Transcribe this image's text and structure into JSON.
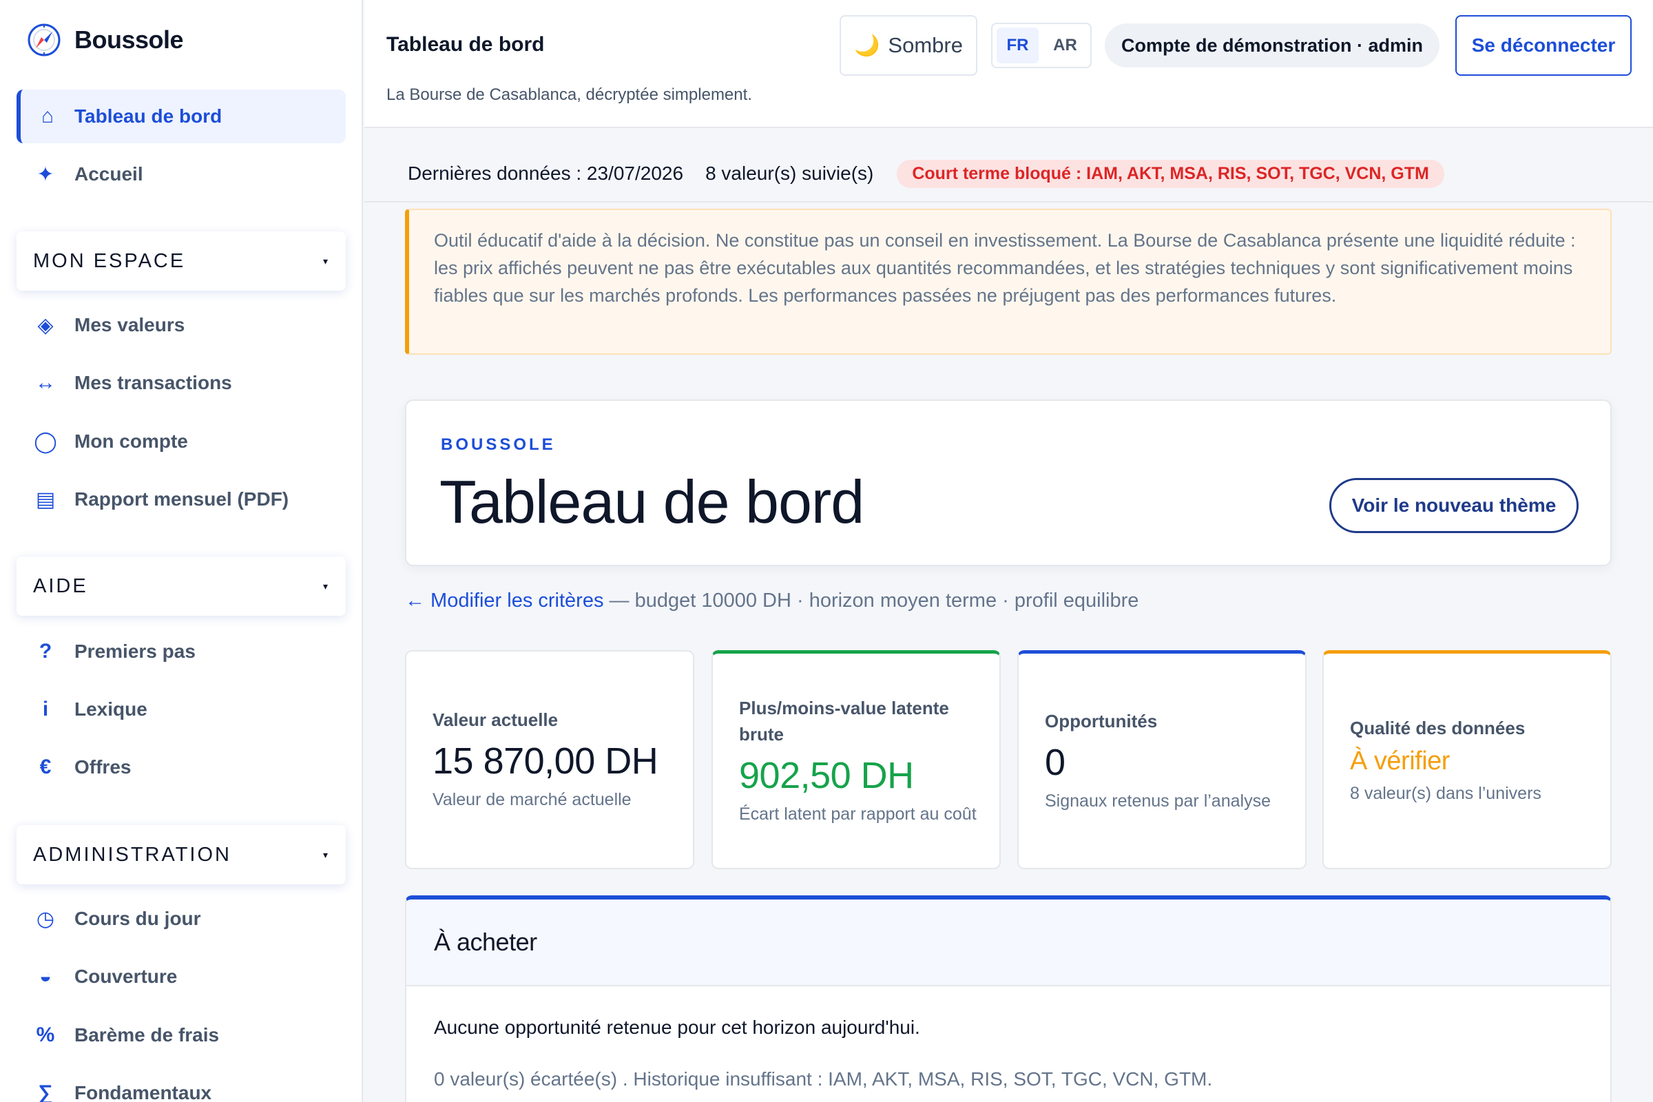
{
  "brand": {
    "name": "Boussole"
  },
  "sidebar": {
    "primary": [
      {
        "label": "Tableau de bord",
        "icon": "home-icon",
        "glyph": "⌂",
        "active": true
      },
      {
        "label": "Accueil",
        "icon": "sparkle-icon",
        "glyph": "✦",
        "active": false
      }
    ],
    "sections": [
      {
        "title": "MON ESPACE",
        "items": [
          {
            "label": "Mes valeurs",
            "icon": "diamond-icon",
            "glyph": "◈"
          },
          {
            "label": "Mes transactions",
            "icon": "arrows-horizontal-icon",
            "glyph": "↔"
          },
          {
            "label": "Mon compte",
            "icon": "circle-icon",
            "glyph": "◯"
          },
          {
            "label": "Rapport mensuel (PDF)",
            "icon": "document-icon",
            "glyph": "▤"
          }
        ]
      },
      {
        "title": "AIDE",
        "items": [
          {
            "label": "Premiers pas",
            "icon": "question-icon",
            "glyph": "?"
          },
          {
            "label": "Lexique",
            "icon": "info-icon",
            "glyph": "i"
          },
          {
            "label": "Offres",
            "icon": "euro-icon",
            "glyph": "€"
          }
        ]
      },
      {
        "title": "ADMINISTRATION",
        "items": [
          {
            "label": "Cours du jour",
            "icon": "clock-icon",
            "glyph": "◷"
          },
          {
            "label": "Couverture",
            "icon": "half-circle-icon",
            "glyph": "◒"
          },
          {
            "label": "Barème de frais",
            "icon": "percent-icon",
            "glyph": "%"
          },
          {
            "label": "Fondamentaux",
            "icon": "sigma-icon",
            "glyph": "∑"
          }
        ]
      }
    ]
  },
  "header": {
    "title": "Tableau de bord",
    "tagline": "La Bourse de Casablanca, décryptée simplement.",
    "theme_icon": "🌙",
    "theme_label": "Sombre",
    "languages": [
      "FR",
      "AR"
    ],
    "active_language": "FR",
    "account": "Compte de démonstration · admin",
    "logout": "Se déconnecter"
  },
  "status": {
    "last_data": "Dernières données : 23/07/2026",
    "tracked": "8 valeur(s) suivie(s)",
    "blocked": "Court terme bloqué : IAM, AKT, MSA, RIS, SOT, TGC, VCN, GTM"
  },
  "disclaimer": "Outil éducatif d'aide à la décision. Ne constitue pas un conseil en investissement. La Bourse de Casablanca présente une liquidité réduite : les prix affichés peuvent ne pas être exécutables aux quantités recommandées, et les stratégies techniques y sont significativement moins fiables que sur les marchés profonds. Les performances passées ne préjugent pas des performances futures.",
  "hero": {
    "eyebrow": "BOUSSOLE",
    "title": "Tableau de bord",
    "button": "Voir le nouveau thème"
  },
  "criteria": {
    "link": "← Modifier les critères",
    "summary": " — budget 10000 DH · horizon moyen terme · profil equilibre"
  },
  "kpis": [
    {
      "label": "Valeur actuelle",
      "value": "15 870,00 DH",
      "note": "Valeur de marché actuelle"
    },
    {
      "label": "Plus/moins-value latente brute",
      "value": "902,50 DH",
      "note": "Écart latent par rapport au coût",
      "color": "#16a34a"
    },
    {
      "label": "Opportunités",
      "value": "0",
      "note": "Signaux retenus par l’analyse"
    },
    {
      "label": "Qualité des données",
      "value": "À vérifier",
      "note": "8 valeur(s) dans l’univers",
      "color": "#f59e0b"
    }
  ],
  "buy": {
    "title": "À acheter",
    "message": "Aucune opportunité retenue pour cet horizon aujourd'hui.",
    "excluded": "0 valeur(s) écartée(s) . Historique insuffisant : IAM, AKT, MSA, RIS, SOT, TGC, VCN, GTM."
  },
  "colors": {
    "accent": "#1d4ed8",
    "positive": "#16a34a",
    "warning": "#f59e0b",
    "danger": "#dc2626"
  }
}
